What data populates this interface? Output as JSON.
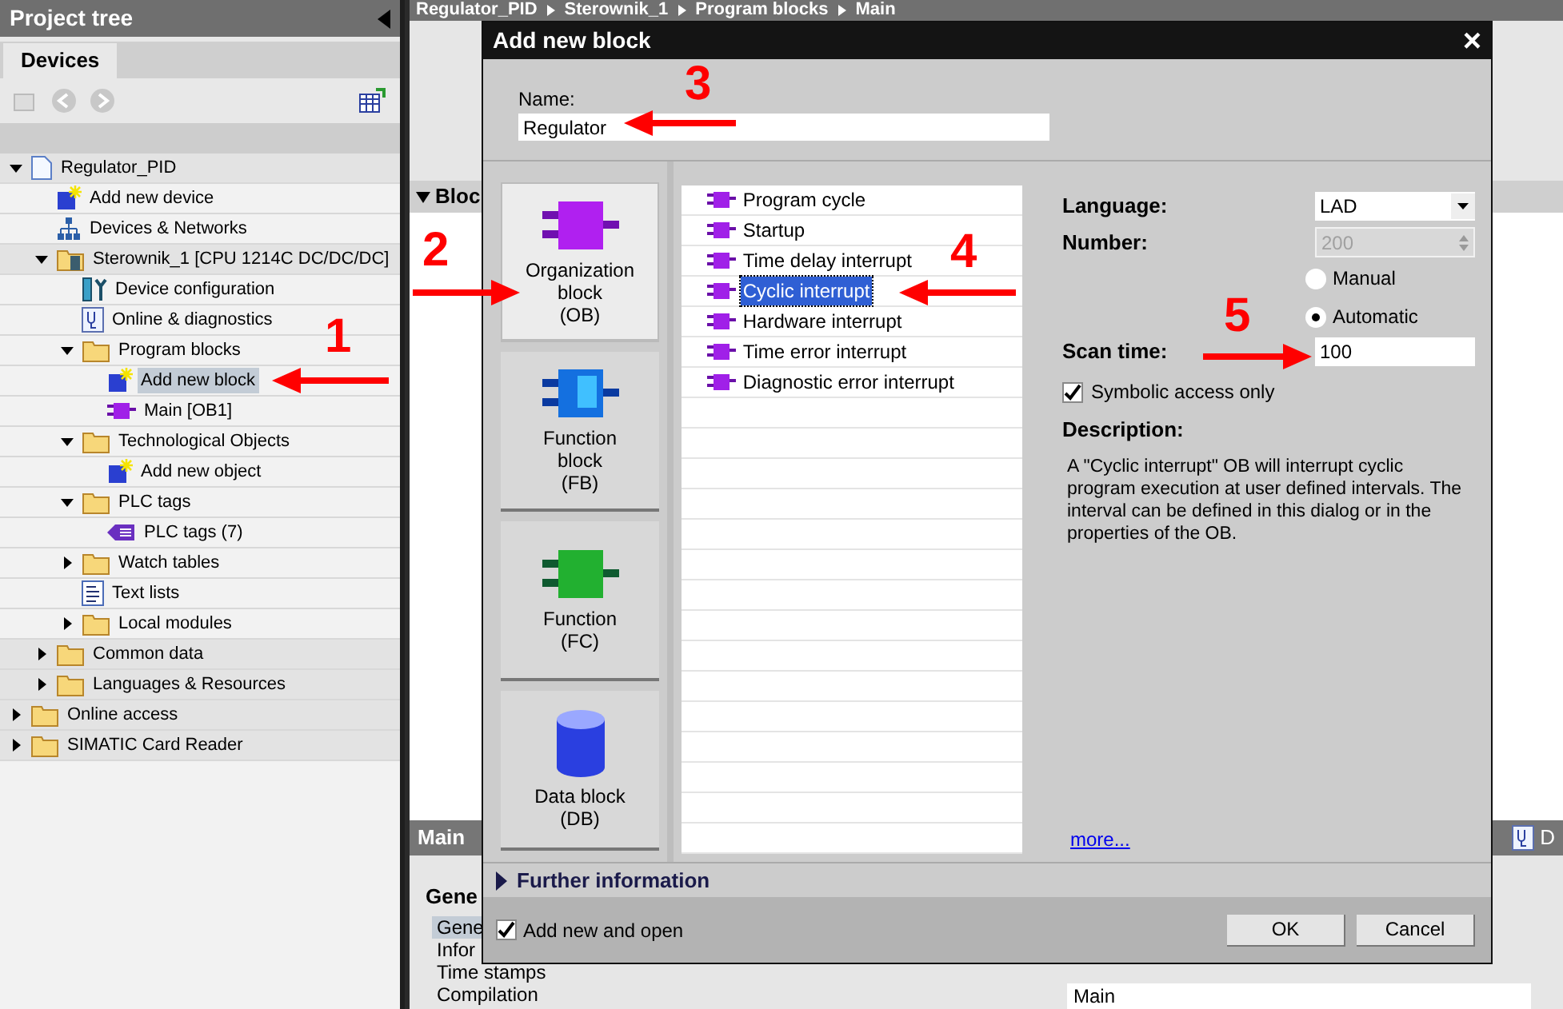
{
  "project_tree": {
    "title": "Project tree",
    "tab": "Devices",
    "items": [
      {
        "label": "Regulator_PID",
        "kind": "project",
        "expanded": true,
        "selected": false,
        "children": [
          {
            "label": "Add new device",
            "kind": "add",
            "selected": false
          },
          {
            "label": "Devices & Networks",
            "kind": "network",
            "selected": false
          },
          {
            "label": "Sterownik_1 [CPU 1214C DC/DC/DC]",
            "kind": "plc",
            "expanded": true,
            "selected": false,
            "children": [
              {
                "label": "Device configuration",
                "kind": "devconf",
                "selected": false
              },
              {
                "label": "Online & diagnostics",
                "kind": "diag",
                "selected": false
              },
              {
                "label": "Program blocks",
                "kind": "folder",
                "expanded": true,
                "selected": false,
                "children": [
                  {
                    "label": "Add new block",
                    "kind": "add",
                    "selected": true
                  },
                  {
                    "label": "Main [OB1]",
                    "kind": "ob",
                    "selected": false
                  }
                ]
              },
              {
                "label": "Technological Objects",
                "kind": "folder",
                "expanded": true,
                "selected": false,
                "children": [
                  {
                    "label": "Add new object",
                    "kind": "add",
                    "selected": false
                  }
                ]
              },
              {
                "label": "PLC tags",
                "kind": "folder",
                "expanded": true,
                "selected": false,
                "children": [
                  {
                    "label": "PLC tags (7)",
                    "kind": "tags",
                    "selected": false
                  }
                ]
              },
              {
                "label": "Watch tables",
                "kind": "folder",
                "expanded": false,
                "selected": false
              },
              {
                "label": "Text lists",
                "kind": "textlist",
                "selected": false
              },
              {
                "label": "Local modules",
                "kind": "folder",
                "expanded": false,
                "selected": false
              }
            ]
          },
          {
            "label": "Common data",
            "kind": "folder",
            "expanded": false,
            "selected": false
          },
          {
            "label": "Languages & Resources",
            "kind": "folder",
            "expanded": false,
            "selected": false
          }
        ]
      },
      {
        "label": "Online access",
        "kind": "folder",
        "expanded": false,
        "selected": false
      },
      {
        "label": "SIMATIC Card Reader",
        "kind": "folder",
        "expanded": false,
        "selected": false
      }
    ]
  },
  "editor": {
    "breadcrumb": [
      "Regulator_PID",
      "Sterownik_1",
      "Program blocks",
      "Main"
    ],
    "section": "Bloc",
    "properties_tab": "Main",
    "properties_heading": "Gene",
    "properties_items": [
      {
        "label": "Gene",
        "selected": true
      },
      {
        "label": "Infor",
        "selected": false
      },
      {
        "label": "Time stamps",
        "selected": false
      },
      {
        "label": "Compilation",
        "selected": false
      }
    ],
    "side_label": "D",
    "name_value": "Main"
  },
  "dialog": {
    "title": "Add new block",
    "close": "×",
    "name_label": "Name:",
    "name_value": "Regulator",
    "block_types": [
      {
        "label": "Organization\nblock\n(OB)",
        "kind": "ob",
        "selected": true
      },
      {
        "label": "Function\nblock\n(FB)",
        "kind": "fb",
        "selected": false
      },
      {
        "label": "Function\n(FC)",
        "kind": "fc",
        "selected": false
      },
      {
        "label": "Data block\n(DB)",
        "kind": "db",
        "selected": false
      }
    ],
    "ob_list": [
      {
        "label": "Program cycle",
        "selected": false
      },
      {
        "label": "Startup",
        "selected": false
      },
      {
        "label": "Time delay interrupt",
        "selected": false
      },
      {
        "label": "Cyclic interrupt",
        "selected": true
      },
      {
        "label": "Hardware interrupt",
        "selected": false
      },
      {
        "label": "Time error interrupt",
        "selected": false
      },
      {
        "label": "Diagnostic error interrupt",
        "selected": false
      }
    ],
    "language_label": "Language:",
    "language_value": "LAD",
    "number_label": "Number:",
    "number_value": "200",
    "number_modes": [
      {
        "label": "Manual",
        "selected": false
      },
      {
        "label": "Automatic",
        "selected": true
      }
    ],
    "scan_time_label": "Scan time:",
    "scan_time_value": "100",
    "symbolic_access": {
      "label": "Symbolic access only",
      "checked": true
    },
    "description_label": "Description:",
    "description": "A \"Cyclic interrupt\" OB will interrupt cyclic program execution at user defined intervals. The interval can be defined in this dialog or in the properties of the OB.",
    "more_link": "more...",
    "further_information": "Further information",
    "add_and_open": {
      "label": "Add new and open",
      "checked": true
    },
    "buttons": [
      "OK",
      "Cancel"
    ]
  },
  "annotations": [
    {
      "label": "1"
    },
    {
      "label": "2"
    },
    {
      "label": "3"
    },
    {
      "label": "4"
    },
    {
      "label": "5"
    }
  ]
}
